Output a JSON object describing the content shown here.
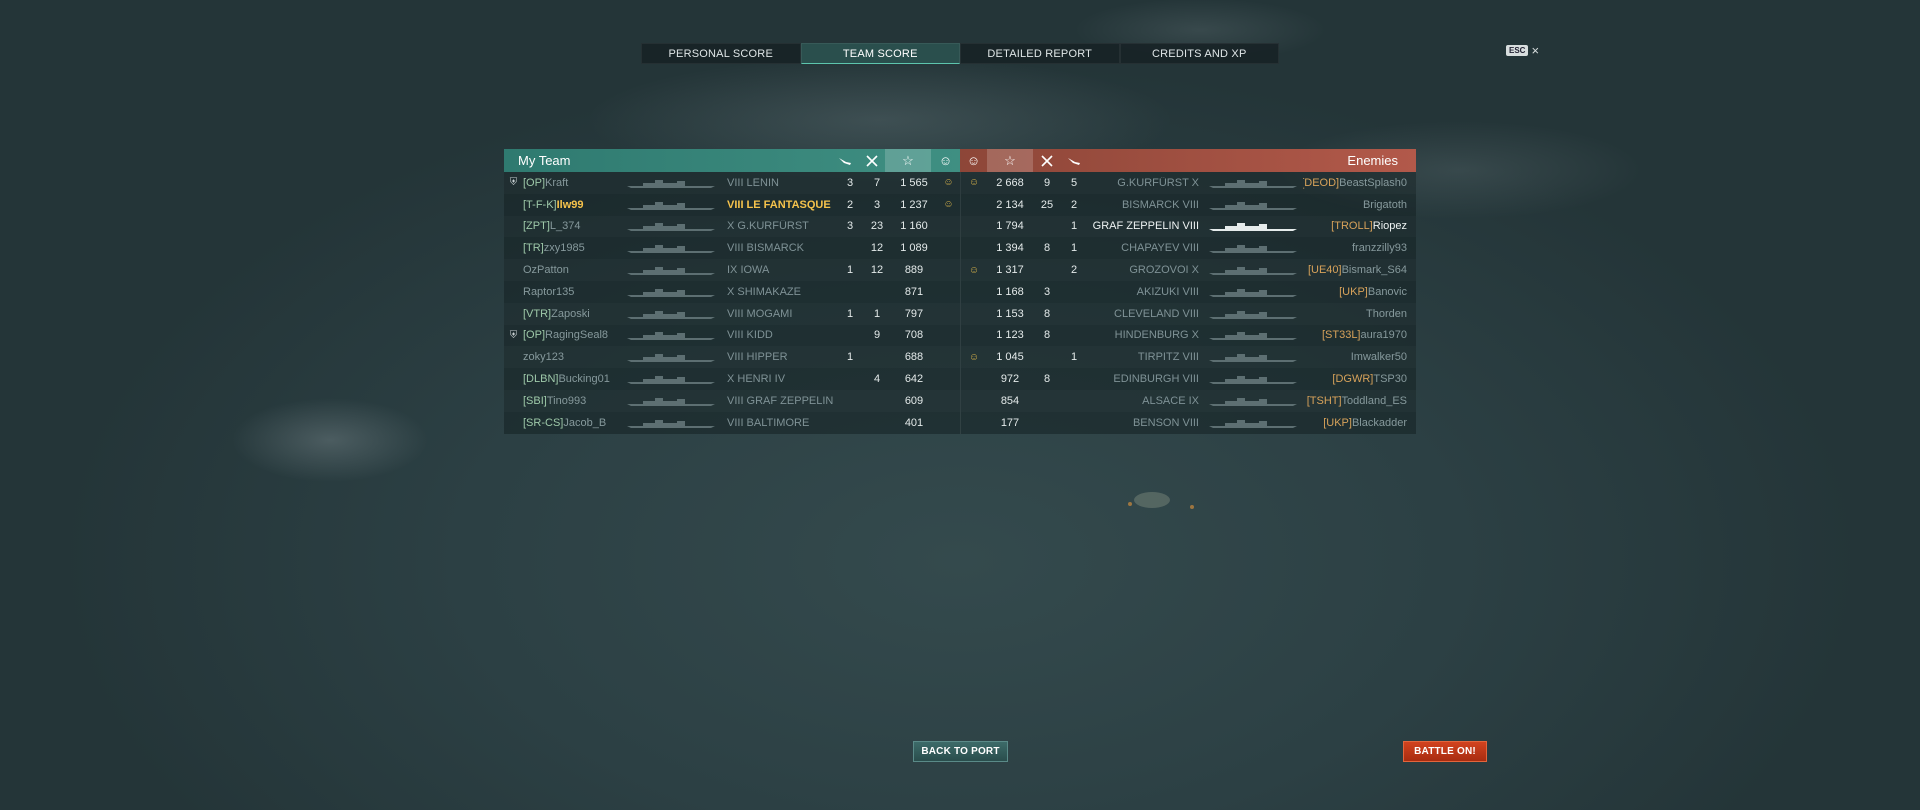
{
  "tabs": [
    {
      "label": "PERSONAL SCORE",
      "active": false
    },
    {
      "label": "TEAM SCORE",
      "active": true
    },
    {
      "label": "DETAILED REPORT",
      "active": false
    },
    {
      "label": "CREDITS AND XP",
      "active": false
    }
  ],
  "esc": {
    "key": "ESC",
    "close": "×"
  },
  "my_team": {
    "title": "My Team",
    "header_icons": [
      "plane-icon",
      "swords-icon",
      "star-icon",
      "smile-badge-icon"
    ],
    "rows": [
      {
        "clan": "[OP]",
        "name": "Kraft",
        "ship": "VIII LENIN",
        "planes": "3",
        "kills": "7",
        "xp": "1 565",
        "badge": "☺",
        "leader": "⛨"
      },
      {
        "clan": "[T-F-K]",
        "name": "Ilw99",
        "ship": "VIII LE FANTASQUE",
        "planes": "2",
        "kills": "3",
        "xp": "1 237",
        "badge": "☺",
        "self": true
      },
      {
        "clan": "[ZPT]",
        "name": "L_374",
        "ship": "X G.KURFÜRST",
        "planes": "3",
        "kills": "23",
        "xp": "1 160",
        "badge": ""
      },
      {
        "clan": "[TR]",
        "name": "zxy1985",
        "ship": "VIII BISMARCK",
        "planes": "",
        "kills": "12",
        "xp": "1 089",
        "badge": ""
      },
      {
        "clan": "",
        "name": "OzPatton",
        "ship": "IX IOWA",
        "planes": "1",
        "kills": "12",
        "xp": "889",
        "badge": ""
      },
      {
        "clan": "",
        "name": "Raptor135",
        "ship": "X SHIMAKAZE",
        "planes": "",
        "kills": "",
        "xp": "871",
        "badge": ""
      },
      {
        "clan": "[VTR]",
        "name": "Zaposki",
        "ship": "VIII MOGAMI",
        "planes": "1",
        "kills": "1",
        "xp": "797",
        "badge": ""
      },
      {
        "clan": "[OP]",
        "name": "RagingSeal8",
        "ship": "VIII KIDD",
        "planes": "",
        "kills": "9",
        "xp": "708",
        "badge": "",
        "leader": "⛨"
      },
      {
        "clan": "",
        "name": "zoky123",
        "ship": "VIII HIPPER",
        "planes": "1",
        "kills": "",
        "xp": "688",
        "badge": ""
      },
      {
        "clan": "[DLBN]",
        "name": "Bucking01",
        "ship": "X HENRI IV",
        "planes": "",
        "kills": "4",
        "xp": "642",
        "badge": ""
      },
      {
        "clan": "[SBI]",
        "name": "Tino993",
        "ship": "VIII GRAF ZEPPELIN",
        "planes": "",
        "kills": "",
        "xp": "609",
        "badge": ""
      },
      {
        "clan": "[SR-CS]",
        "name": "Jacob_B",
        "ship": "VIII BALTIMORE",
        "planes": "",
        "kills": "",
        "xp": "401",
        "badge": ""
      }
    ]
  },
  "enemies": {
    "title": "Enemies",
    "header_icons": [
      "smile-badge-icon",
      "star-icon",
      "swords-icon",
      "plane-icon"
    ],
    "rows": [
      {
        "badge": "☺",
        "xp": "2 668",
        "kills": "9",
        "planes": "5",
        "ship": "G.KURFÜRST X",
        "clan": "[DEOD]",
        "name": "BeastSplash0"
      },
      {
        "badge": "",
        "xp": "2 134",
        "kills": "25",
        "planes": "2",
        "ship": "BISMARCK VIII",
        "clan": "",
        "name": "Brigatoth"
      },
      {
        "badge": "",
        "xp": "1 794",
        "kills": "",
        "planes": "1",
        "ship": "GRAF ZEPPELIN VIII",
        "clan": "[TROLL]",
        "name": "Riopez",
        "bright": true
      },
      {
        "badge": "",
        "xp": "1 394",
        "kills": "8",
        "planes": "1",
        "ship": "CHAPAYEV VIII",
        "clan": "",
        "name": "franzzilly93"
      },
      {
        "badge": "☺",
        "xp": "1 317",
        "kills": "",
        "planes": "2",
        "ship": "GROZOVOI X",
        "clan": "[UE40]",
        "name": "Bismark_S64"
      },
      {
        "badge": "",
        "xp": "1 168",
        "kills": "3",
        "planes": "",
        "ship": "AKIZUKI VIII",
        "clan": "[UKP]",
        "name": "Banovic"
      },
      {
        "badge": "",
        "xp": "1 153",
        "kills": "8",
        "planes": "",
        "ship": "CLEVELAND VIII",
        "clan": "",
        "name": "Thorden"
      },
      {
        "badge": "",
        "xp": "1 123",
        "kills": "8",
        "planes": "",
        "ship": "HINDENBURG X",
        "clan": "[ST33L]",
        "name": "aura1970"
      },
      {
        "badge": "☺",
        "xp": "1 045",
        "kills": "",
        "planes": "1",
        "ship": "TIRPITZ VIII",
        "clan": "",
        "name": "Imwalker50"
      },
      {
        "badge": "",
        "xp": "972",
        "kills": "8",
        "planes": "",
        "ship": "EDINBURGH VIII",
        "clan": "[DGWR]",
        "name": "TSP30"
      },
      {
        "badge": "",
        "xp": "854",
        "kills": "",
        "planes": "",
        "ship": "ALSACE IX",
        "clan": "[TSHT]",
        "name": "Toddland_ES"
      },
      {
        "badge": "",
        "xp": "177",
        "kills": "",
        "planes": "",
        "ship": "BENSON VIII",
        "clan": "[UKP]",
        "name": "Blackadder"
      }
    ]
  },
  "buttons": {
    "back": "BACK TO PORT",
    "battle": "BATTLE ON!"
  },
  "colors": {
    "my_team": "#3a8b7e",
    "enemies": "#b05646",
    "self_highlight": "#f6c34c",
    "battle_button": "#c43a18"
  }
}
